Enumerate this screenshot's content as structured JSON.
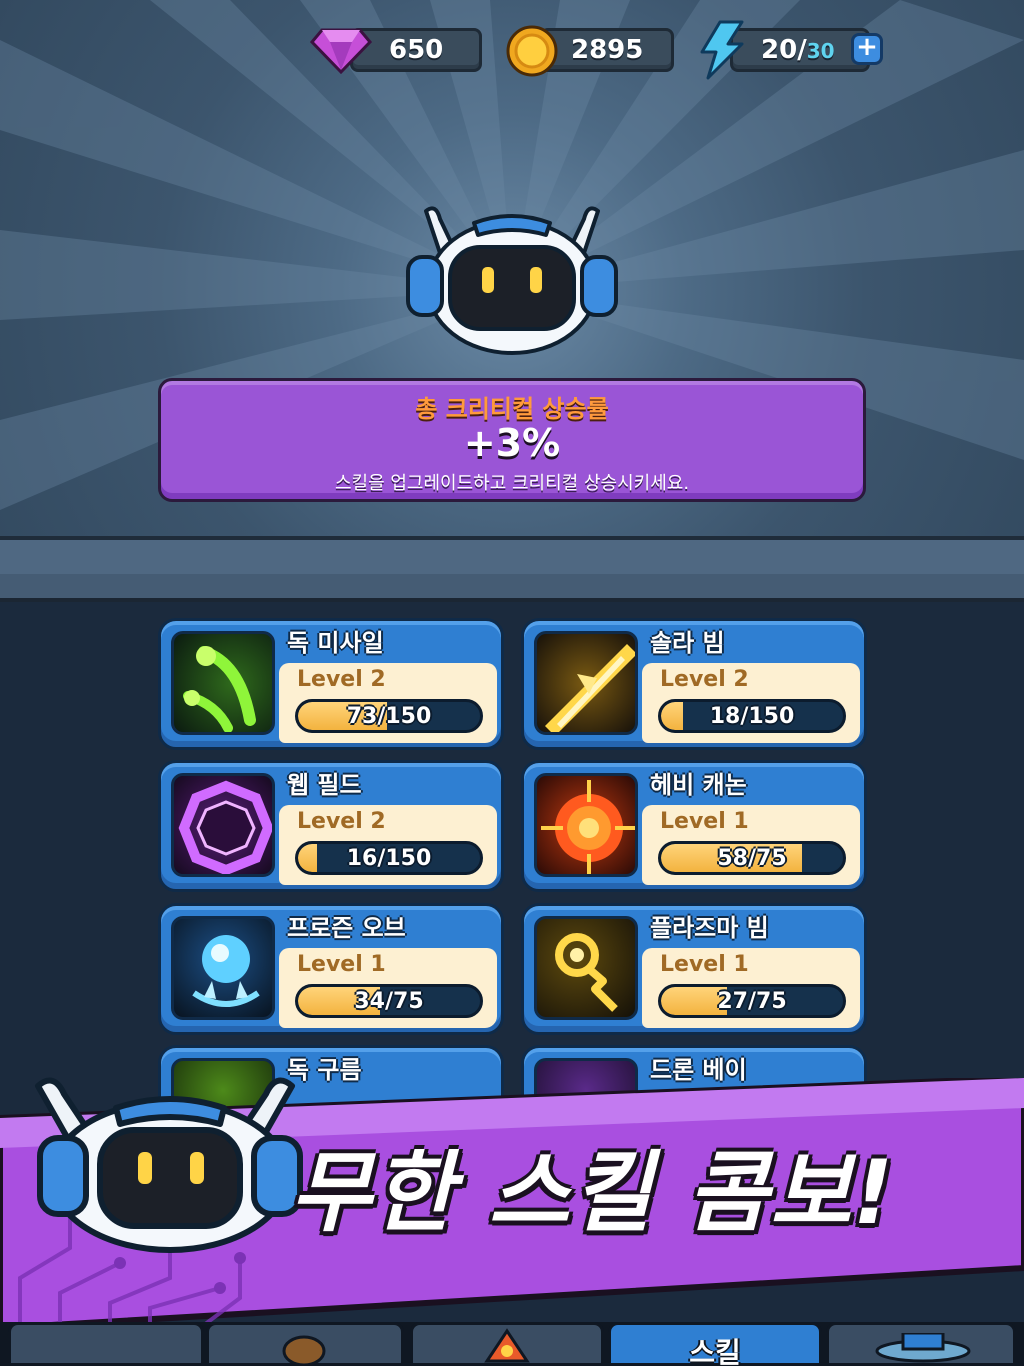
{
  "currencies": {
    "gems": "650",
    "coins": "2895",
    "energy_current": "20",
    "energy_separator": "/",
    "energy_max": "30",
    "add_label": "+"
  },
  "info_panel": {
    "title": "총 크리티컬 상승률",
    "value": "+3%",
    "description": "스킬을 업그레이드하고 크리티컬 상승시키세요."
  },
  "skills": [
    {
      "name": "독 미사일",
      "level": "Level 2",
      "progress": "73/150",
      "fraction": 0.487,
      "icon": "poison-missile-icon"
    },
    {
      "name": "솔라 빔",
      "level": "Level 2",
      "progress": "18/150",
      "fraction": 0.12,
      "icon": "solar-beam-icon"
    },
    {
      "name": "웹 필드",
      "level": "Level 2",
      "progress": "16/150",
      "fraction": 0.107,
      "icon": "web-field-icon"
    },
    {
      "name": "헤비 캐논",
      "level": "Level 1",
      "progress": "58/75",
      "fraction": 0.773,
      "icon": "heavy-cannon-icon"
    },
    {
      "name": "프로즌 오브",
      "level": "Level 1",
      "progress": "34/75",
      "fraction": 0.453,
      "icon": "frozen-orb-icon"
    },
    {
      "name": "플라즈마 빔",
      "level": "Level 1",
      "progress": "27/75",
      "fraction": 0.36,
      "icon": "plasma-beam-icon"
    },
    {
      "name": "독 구름",
      "icon": "poison-cloud-icon"
    },
    {
      "name": "드론 베이",
      "icon": "drone-bay-icon"
    }
  ],
  "banner": {
    "text": "무한 스킬 콤보!"
  },
  "nav": {
    "active_tab": "스킬"
  },
  "colors": {
    "accent_purple": "#9a55d6",
    "card_blue": "#2f7fd2",
    "progress_gold": "#f3b33f",
    "title_orange": "#ff9a3c"
  }
}
